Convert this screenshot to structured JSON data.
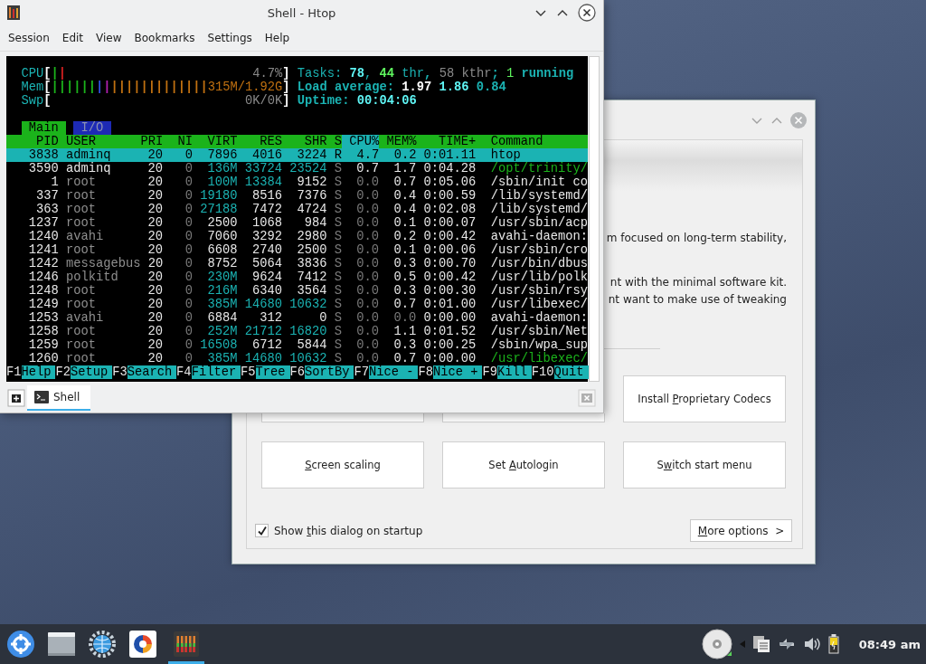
{
  "dialog": {
    "text_lines": [
      "m focused on long-term stability,",
      "nt with the minimal software kit.",
      "nt want to make use of tweaking"
    ],
    "buttons": [
      {
        "pre": "Install ",
        "key": "P",
        "post": "roprietary Codecs"
      },
      {
        "key": "S",
        "post": "creen scaling"
      },
      {
        "pre": "Set ",
        "key": "A",
        "post": "utologin"
      },
      {
        "pre": "S",
        "key": "w",
        "post": "itch start menu"
      }
    ],
    "startup_checkbox": {
      "pre": "Show ",
      "key": "t",
      "post": "his dialog on startup",
      "checked": true
    },
    "more_options": {
      "key": "M",
      "post": "ore options",
      "arrow": ">"
    }
  },
  "window": {
    "title": "Shell - Htop",
    "menu": [
      "Session",
      "Edit",
      "View",
      "Bookmarks",
      "Settings",
      "Help"
    ],
    "tabs": [
      {
        "label": "Shell",
        "selected": true
      }
    ]
  },
  "htop": {
    "meters": [
      {
        "label": "CPU",
        "open": "[",
        "reading": "4.7%",
        "close": "]",
        "color": "#8a8a8a",
        "segments": [
          {
            "text": "|",
            "color": "#1bb31b"
          },
          {
            "text": "|",
            "color": "#d42020"
          }
        ]
      },
      {
        "label": "Mem",
        "open": "[",
        "reading": "315M/1.92G",
        "close": "]",
        "color": "#c07010",
        "segments": [
          {
            "text": "||||||",
            "color": "#1bb31b"
          },
          {
            "text": "|",
            "color": "#3050e0"
          },
          {
            "text": "|",
            "color": "#b020b0"
          },
          {
            "text": "|||||||||||||",
            "color": "#c07010"
          }
        ]
      },
      {
        "label": "Swp",
        "open": "[",
        "reading": "0K/0K",
        "close": "]",
        "color": "#8a8a8a"
      }
    ],
    "info": [
      {
        "parts": [
          {
            "text": "Tasks: ",
            "color": "#1bb3b3"
          },
          {
            "text": "78",
            "color": "#5ff5f5"
          },
          {
            "text": ", ",
            "color": "#1bb3b3"
          },
          {
            "text": "44",
            "color": "#5ef55e"
          },
          {
            "text": " thr",
            "color": "#1bb3b3"
          },
          {
            "text": ", ",
            "color": "#1bb3b3"
          },
          {
            "text": "58 kthr",
            "color": "#8a8a8a"
          },
          {
            "text": "; ",
            "color": "#1bb3b3"
          },
          {
            "text": "1",
            "color": "#5ef55e"
          },
          {
            "text": " running",
            "color": "#1bb3b3"
          }
        ]
      },
      {
        "parts": [
          {
            "text": "Load average: ",
            "color": "#1bb3b3"
          },
          {
            "text": "1.97 ",
            "color": "#ffffff"
          },
          {
            "text": "1.86 ",
            "color": "#5ff5f5"
          },
          {
            "text": "0.84",
            "color": "#1bb3b3"
          }
        ]
      },
      {
        "parts": [
          {
            "text": "Uptime: ",
            "color": "#1bb3b3"
          },
          {
            "text": "00:04:06",
            "color": "#5ff5f5"
          }
        ]
      }
    ],
    "tabs": [
      {
        "label": "Main",
        "selected": true
      },
      {
        "label": "I/O",
        "selected": false
      }
    ],
    "columns": [
      {
        "label": "PID",
        "sorted": false
      },
      {
        "label": "USER",
        "sorted": false
      },
      {
        "label": "PRI",
        "sorted": false
      },
      {
        "label": "NI",
        "sorted": false
      },
      {
        "label": "VIRT",
        "sorted": false
      },
      {
        "label": "RES",
        "sorted": false
      },
      {
        "label": "SHR",
        "sorted": false
      },
      {
        "label": "S",
        "sorted": false
      },
      {
        "label": "CPU%",
        "sorted": true
      },
      {
        "label": "MEM%",
        "sorted": false
      },
      {
        "label": "TIME+",
        "sorted": false
      },
      {
        "label": "Command",
        "sorted": false
      }
    ],
    "rows": [
      {
        "pid": "3838",
        "user": "adminq",
        "pri": "20",
        "ni": "0",
        "virt": "7896",
        "res": "4016",
        "shr": "3224",
        "s": "R",
        "cpu": "4.7",
        "mem": "0.2",
        "time": "0:01.11",
        "command": "htop",
        "selected": true
      },
      {
        "pid": "3590",
        "user": "adminq",
        "pri": "20",
        "ni": "0",
        "virt": "136M",
        "res": "33724",
        "shr": "23524",
        "s": "S",
        "cpu": "0.7",
        "mem": "1.7",
        "time": "0:04.28",
        "command": "/opt/trinity/",
        "own_user": true,
        "thread": true,
        "selected": false
      },
      {
        "pid": "1",
        "user": "root",
        "pri": "20",
        "ni": "0",
        "virt": "100M",
        "res": "13384",
        "shr": "9152",
        "s": "S",
        "cpu": "0.0",
        "mem": "0.7",
        "time": "0:05.06",
        "command": "/sbin/init co",
        "own_user": false,
        "thread": false,
        "selected": false
      },
      {
        "pid": "337",
        "user": "root",
        "pri": "20",
        "ni": "0",
        "virt": "19180",
        "res": "8516",
        "shr": "7376",
        "s": "S",
        "cpu": "0.0",
        "mem": "0.4",
        "time": "0:00.59",
        "command": "/lib/systemd/",
        "own_user": false,
        "thread": false,
        "selected": false
      },
      {
        "pid": "363",
        "user": "root",
        "pri": "20",
        "ni": "0",
        "virt": "27188",
        "res": "7472",
        "shr": "4724",
        "s": "S",
        "cpu": "0.0",
        "mem": "0.4",
        "time": "0:02.08",
        "command": "/lib/systemd/",
        "own_user": false,
        "thread": false,
        "selected": false
      },
      {
        "pid": "1237",
        "user": "root",
        "pri": "20",
        "ni": "0",
        "virt": "2500",
        "res": "1068",
        "shr": "984",
        "s": "S",
        "cpu": "0.0",
        "mem": "0.1",
        "time": "0:00.07",
        "command": "/usr/sbin/acp",
        "own_user": false,
        "thread": false,
        "selected": false
      },
      {
        "pid": "1240",
        "user": "avahi",
        "pri": "20",
        "ni": "0",
        "virt": "7060",
        "res": "3292",
        "shr": "2980",
        "s": "S",
        "cpu": "0.0",
        "mem": "0.2",
        "time": "0:00.42",
        "command": "avahi-daemon:",
        "own_user": false,
        "thread": false,
        "selected": false
      },
      {
        "pid": "1241",
        "user": "root",
        "pri": "20",
        "ni": "0",
        "virt": "6608",
        "res": "2740",
        "shr": "2500",
        "s": "S",
        "cpu": "0.0",
        "mem": "0.1",
        "time": "0:00.06",
        "command": "/usr/sbin/cro",
        "own_user": false,
        "thread": false,
        "selected": false
      },
      {
        "pid": "1242",
        "user": "messagebus",
        "pri": "20",
        "ni": "0",
        "virt": "8752",
        "res": "5064",
        "shr": "3836",
        "s": "S",
        "cpu": "0.0",
        "mem": "0.3",
        "time": "0:00.70",
        "command": "/usr/bin/dbus",
        "own_user": false,
        "thread": false,
        "selected": false
      },
      {
        "pid": "1246",
        "user": "polkitd",
        "pri": "20",
        "ni": "0",
        "virt": "230M",
        "res": "9624",
        "shr": "7412",
        "s": "S",
        "cpu": "0.0",
        "mem": "0.5",
        "time": "0:00.42",
        "command": "/usr/lib/polk",
        "own_user": false,
        "thread": false,
        "selected": false
      },
      {
        "pid": "1248",
        "user": "root",
        "pri": "20",
        "ni": "0",
        "virt": "216M",
        "res": "6340",
        "shr": "3564",
        "s": "S",
        "cpu": "0.0",
        "mem": "0.3",
        "time": "0:00.30",
        "command": "/usr/sbin/rsy",
        "own_user": false,
        "thread": false,
        "selected": false
      },
      {
        "pid": "1249",
        "user": "root",
        "pri": "20",
        "ni": "0",
        "virt": "385M",
        "res": "14680",
        "shr": "10632",
        "s": "S",
        "cpu": "0.0",
        "mem": "0.7",
        "time": "0:01.00",
        "command": "/usr/libexec/",
        "own_user": false,
        "thread": false,
        "selected": false
      },
      {
        "pid": "1253",
        "user": "avahi",
        "pri": "20",
        "ni": "0",
        "virt": "6884",
        "res": "312",
        "shr": "0",
        "s": "S",
        "cpu": "0.0",
        "mem": "0.0",
        "time": "0:00.00",
        "command": "avahi-daemon:",
        "own_user": false,
        "thread": false,
        "selected": false
      },
      {
        "pid": "1258",
        "user": "root",
        "pri": "20",
        "ni": "0",
        "virt": "252M",
        "res": "21712",
        "shr": "16820",
        "s": "S",
        "cpu": "0.0",
        "mem": "1.1",
        "time": "0:01.52",
        "command": "/usr/sbin/Net",
        "own_user": false,
        "thread": false,
        "selected": false
      },
      {
        "pid": "1259",
        "user": "root",
        "pri": "20",
        "ni": "0",
        "virt": "16508",
        "res": "6712",
        "shr": "5844",
        "s": "S",
        "cpu": "0.0",
        "mem": "0.3",
        "time": "0:00.25",
        "command": "/sbin/wpa_sup",
        "own_user": false,
        "thread": false,
        "selected": false
      },
      {
        "pid": "1260",
        "user": "root",
        "pri": "20",
        "ni": "0",
        "virt": "385M",
        "res": "14680",
        "shr": "10632",
        "s": "S",
        "cpu": "0.0",
        "mem": "0.7",
        "time": "0:00.00",
        "command": "/usr/libexec/",
        "own_user": false,
        "thread": true,
        "selected": false
      }
    ],
    "function_keys": [
      {
        "key": "F1",
        "label": "Help"
      },
      {
        "key": "F2",
        "label": "Setup"
      },
      {
        "key": "F3",
        "label": "Search"
      },
      {
        "key": "F4",
        "label": "Filter"
      },
      {
        "key": "F5",
        "label": "Tree"
      },
      {
        "key": "F6",
        "label": "SortBy"
      },
      {
        "key": "F7",
        "label": "Nice -"
      },
      {
        "key": "F8",
        "label": "Nice +"
      },
      {
        "key": "F9",
        "label": "Kill"
      },
      {
        "key": "F10",
        "label": "Quit"
      }
    ]
  },
  "taskbar": {
    "items": [
      {
        "kind": "start",
        "active": false
      },
      {
        "kind": "window",
        "active": false
      },
      {
        "kind": "globe",
        "active": false
      },
      {
        "kind": "app",
        "active": false
      },
      {
        "kind": "htop",
        "active": true
      }
    ],
    "clock": "08:49 am"
  }
}
